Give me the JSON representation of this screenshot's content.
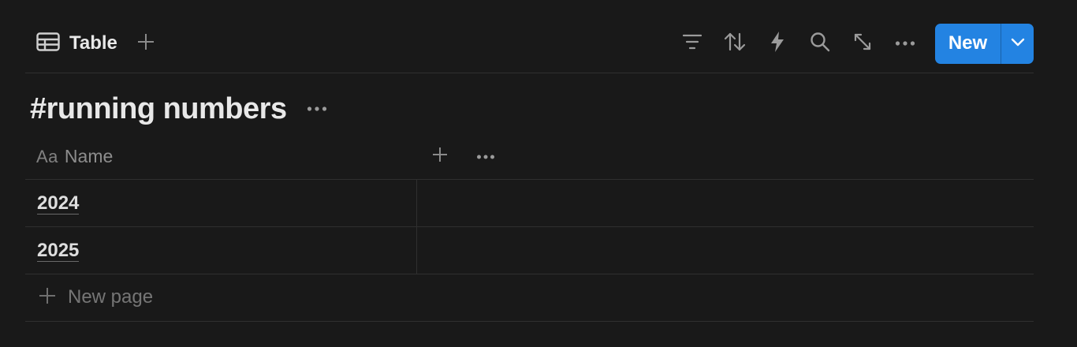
{
  "view": {
    "tab_label": "Table",
    "icons": [
      "table-icon",
      "plus-icon"
    ]
  },
  "toolbar": {
    "icons": [
      "filter-icon",
      "sort-icon",
      "automation-bolt-icon",
      "search-icon",
      "expand-icon",
      "more-icon"
    ],
    "new_label": "New",
    "accent_color": "#2383e2"
  },
  "database": {
    "title": "#running numbers"
  },
  "table": {
    "columns": [
      {
        "type_glyph": "Aa",
        "label": "Name"
      }
    ],
    "rows": [
      {
        "name": "2024"
      },
      {
        "name": "2025"
      }
    ],
    "new_page_label": "New page"
  },
  "colors": {
    "background": "#191919",
    "divider": "#2f2f2f"
  }
}
